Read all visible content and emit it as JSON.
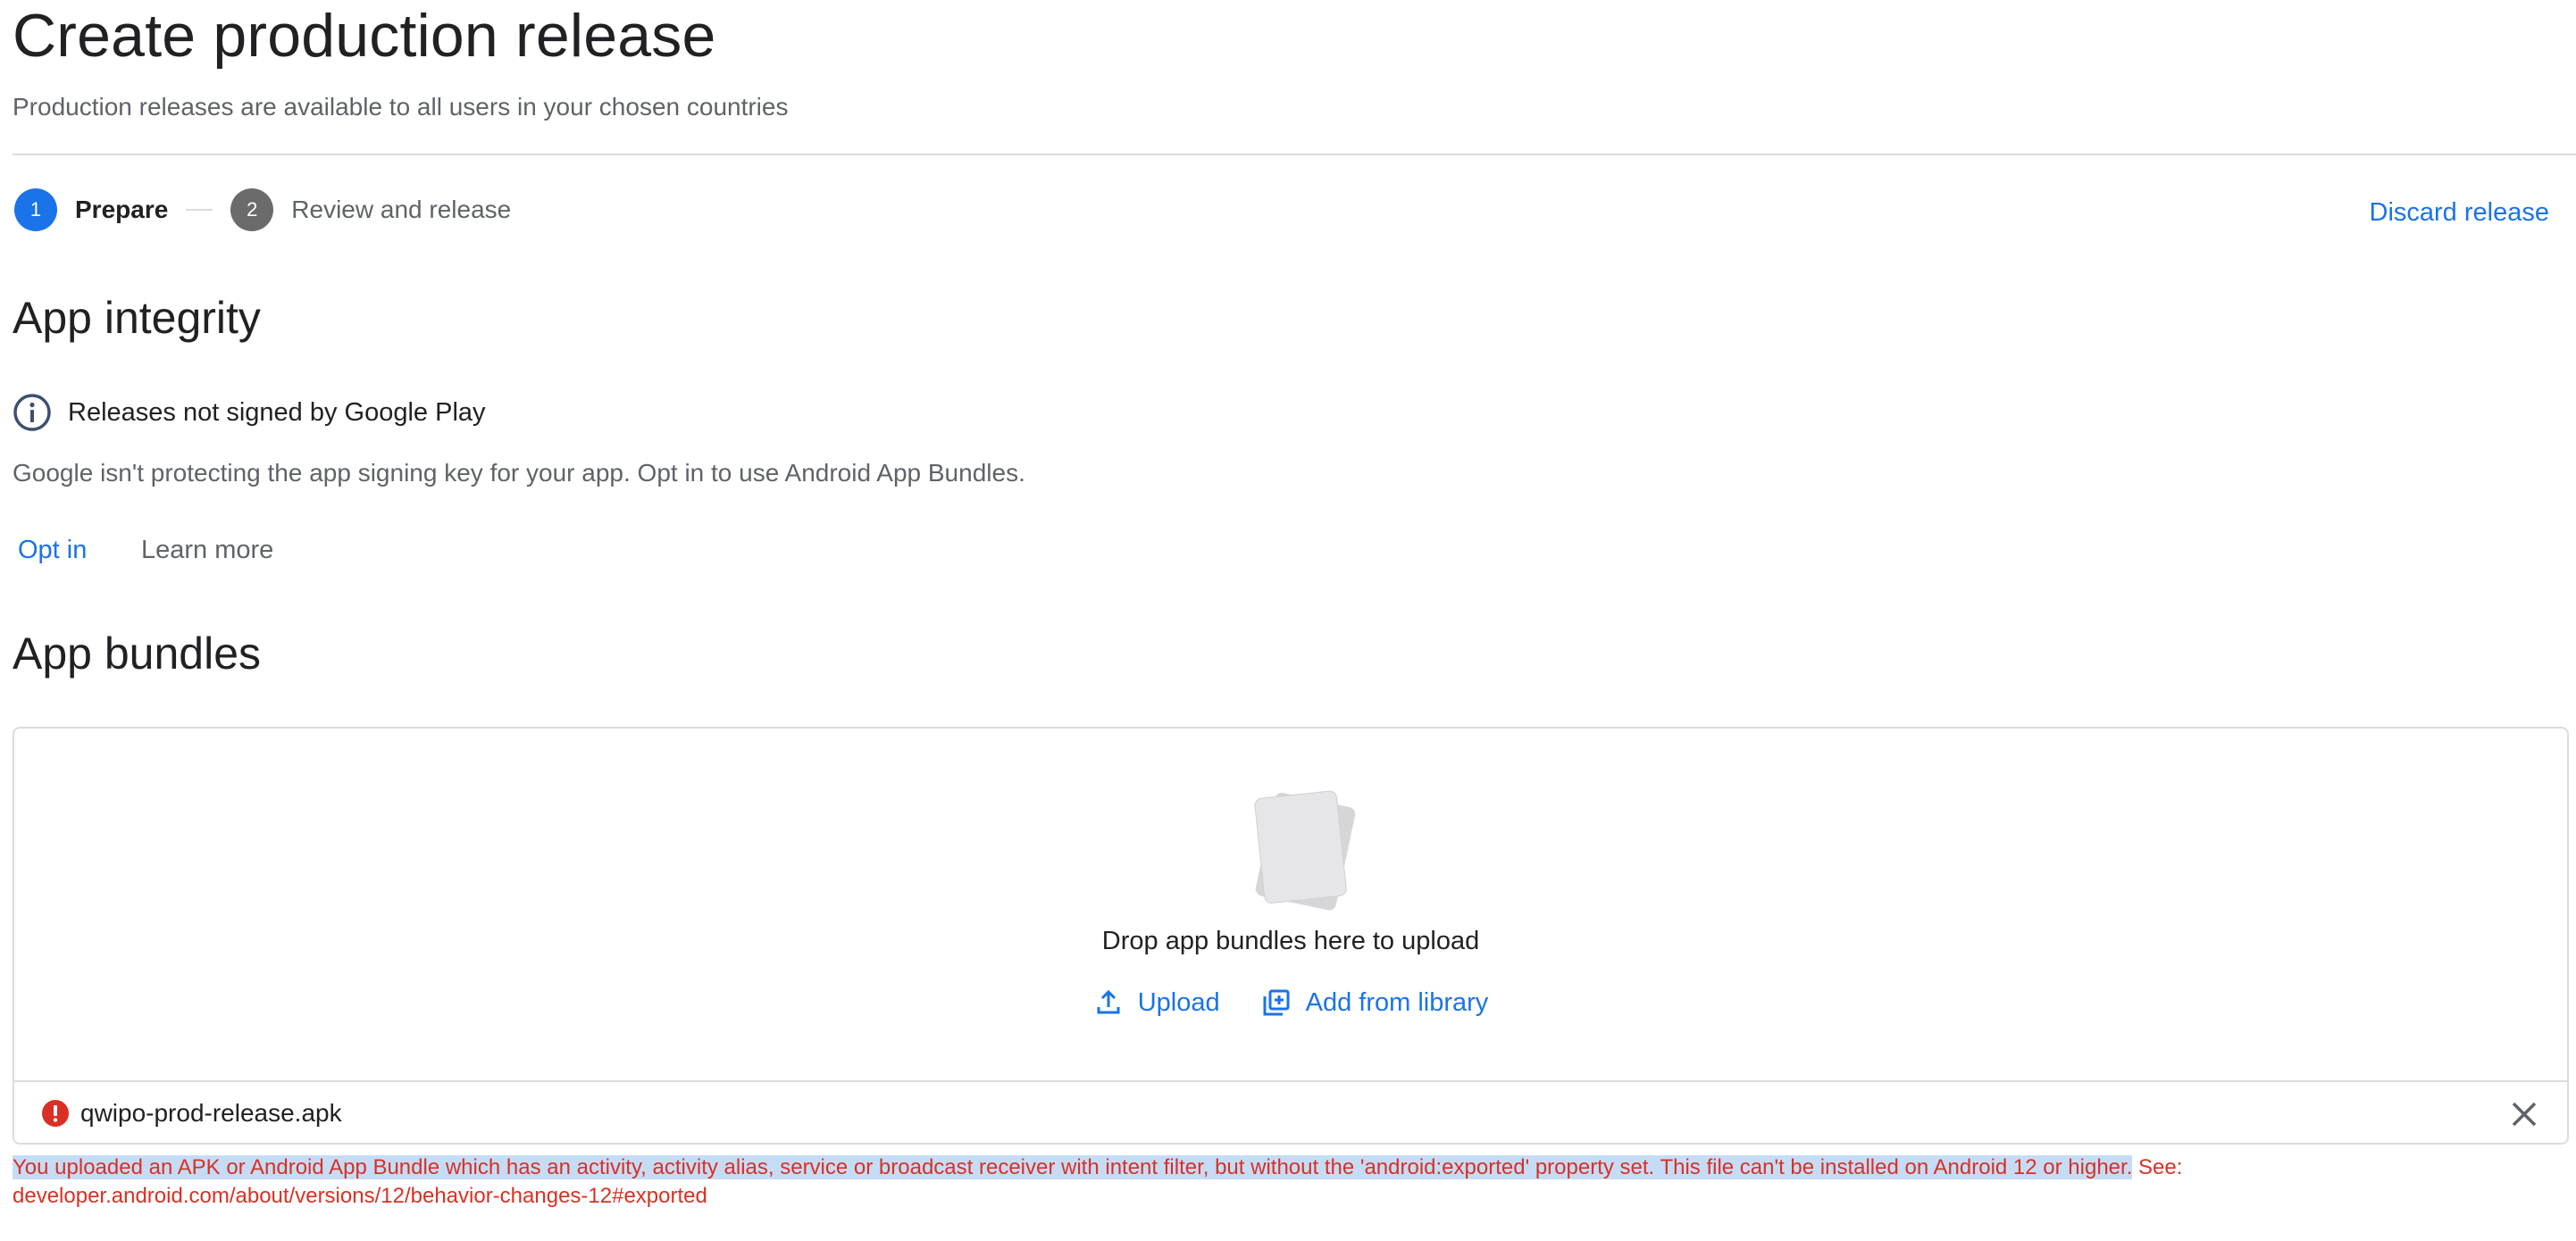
{
  "page": {
    "title": "Create production release",
    "subtitle": "Production releases are available to all users in your chosen countries"
  },
  "stepper": {
    "steps": [
      {
        "number": "1",
        "label": "Prepare",
        "state": "active"
      },
      {
        "number": "2",
        "label": "Review and release",
        "state": "inactive"
      }
    ],
    "discard_label": "Discard release"
  },
  "app_integrity": {
    "title": "App integrity",
    "info_icon": "info-icon",
    "info_text": "Releases not signed by Google Play",
    "description": "Google isn't protecting the app signing key for your app. Opt in to use Android App Bundles.",
    "opt_in_label": "Opt in",
    "learn_more_label": "Learn more"
  },
  "app_bundles": {
    "title": "App bundles",
    "drop_text": "Drop app bundles here to upload",
    "upload_label": "Upload",
    "upload_icon": "upload-icon",
    "library_label": "Add from library",
    "library_icon": "library-add-icon",
    "file": {
      "name": "qwipo-prod-release.apk",
      "status_icon": "error-icon",
      "remove_icon": "close-icon"
    },
    "error_highlighted": "You uploaded an APK or Android App Bundle which has an activity, activity alias, service or broadcast receiver with intent filter, but without the 'android:exported' property set. This file can't be installed on Android 12 or higher.",
    "error_rest": " See: developer.android.com/about/versions/12/behavior-changes-12#exported"
  },
  "colors": {
    "accent": "#1a73e8",
    "error": "#d93025",
    "text": "#202124",
    "muted": "#5f6368",
    "highlight": "#c6dcf5"
  }
}
